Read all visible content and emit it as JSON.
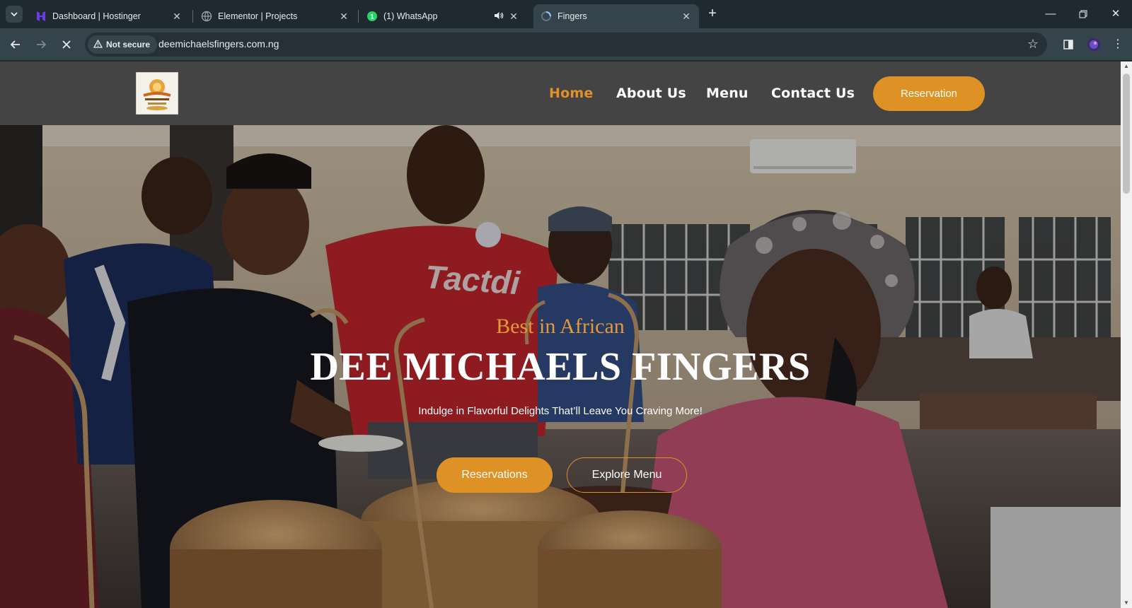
{
  "browser": {
    "tabs": [
      {
        "title": "Dashboard | Hostinger",
        "icon": "hostinger-icon",
        "active": false
      },
      {
        "title": "Elementor | Projects",
        "icon": "globe-icon",
        "active": false
      },
      {
        "title": "(1) WhatsApp",
        "icon": "whatsapp-icon",
        "active": false,
        "badge": "1"
      },
      {
        "title": "Fingers",
        "icon": "loading-spinner-icon",
        "active": true
      }
    ],
    "security_label": "Not secure",
    "url": "deemichaelsfingers.com.ng"
  },
  "site": {
    "nav": {
      "home": "Home",
      "about": "About Us",
      "menu": "Menu",
      "contact": "Contact Us",
      "reservation": "Reservation"
    },
    "hero": {
      "eyebrow": "Best in African",
      "title": "DEE MICHAELS FINGERS",
      "subtitle": "Indulge in Flavorful Delights That’ll Leave You Craving More!",
      "primary_button": "Reservations",
      "secondary_button": "Explore Menu"
    }
  },
  "colors": {
    "accent": "#de9124",
    "header_bg": "#444444",
    "chrome_bg": "#1f2a30"
  }
}
